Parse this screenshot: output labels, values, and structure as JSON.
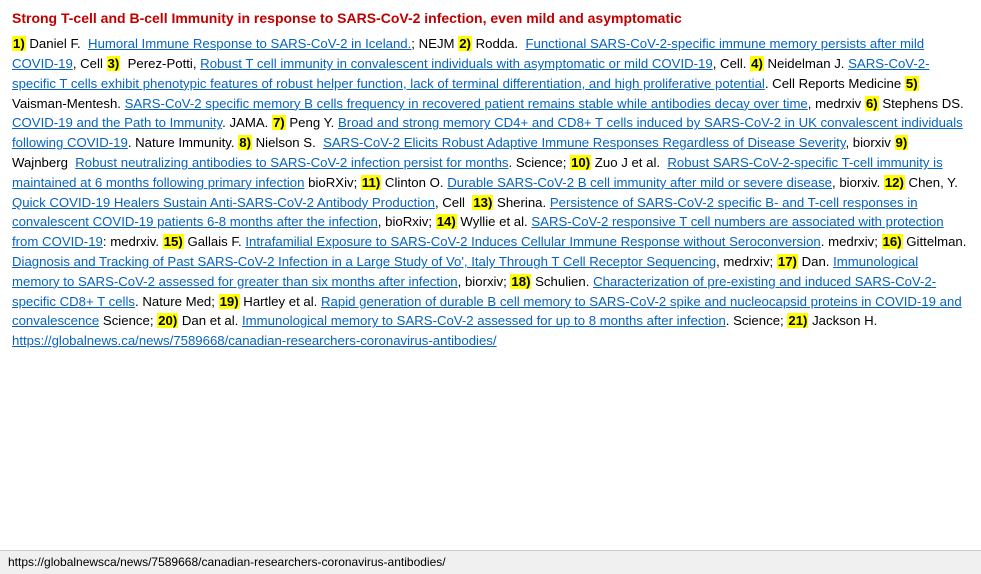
{
  "title": "Strong T-cell and B-cell Immunity in response to SARS-CoV-2 infection, even mild and asymptomatic",
  "statusBar": "https://globalnewsca/news/7589668/canadian-researchers-coronavirus-antibodies/",
  "refs": [
    {
      "num": "1)",
      "author": "Daniel F. ",
      "linkText": "Humoral Immune Response to SARS-CoV-2 in Iceland.",
      "rest": "; NEJM "
    },
    {
      "num": "2)",
      "author": "Rodda. ",
      "linkText": "Functional SARS-CoV-2-specific immune memory persists after mild COVID-19",
      "rest": ", Cell "
    },
    {
      "num": "3)",
      "author": "Perez-Potti, ",
      "linkText": "Robust T cell immunity in convalescent individuals with asymptomatic or mild COVID-19",
      "rest": ", Cell. "
    },
    {
      "num": "4)",
      "author": "Neidelman J. ",
      "linkText": "SARS-CoV-2-specific T cells exhibit phenotypic features of robust helper function, lack of terminal differentiation, and high proliferative potential",
      "rest": ". Cell Reports Medicine "
    },
    {
      "num": "5)",
      "author": "Vaisman-Mentesh. ",
      "linkText": "SARS-CoV-2 specific memory B cells frequency in recovered patient remains stable while antibodies decay over time",
      "rest": ", medrxiv "
    },
    {
      "num": "6)",
      "author": "Stephens DS. ",
      "linkText": "COVID-19 and the Path to Immunity",
      "rest": ". JAMA. "
    },
    {
      "num": "7)",
      "author": "Peng Y. ",
      "linkText": "Broad and strong memory CD4+ and CD8+ T cells induced by SARS-CoV-2 in UK convalescent individuals following COVID-19",
      "rest": ". Nature Immunity. "
    },
    {
      "num": "8)",
      "author": "Nielson S. ",
      "linkText": "SARS-CoV-2 Elicits Robust Adaptive Immune Responses Regardless of Disease Severity",
      "rest": ", biorxiv "
    },
    {
      "num": "9)",
      "author": "Wajnberg ",
      "linkText": "Robust neutralizing antibodies to SARS-CoV-2 infection persist for months",
      "rest": ". Science; "
    },
    {
      "num": "10)",
      "author": "Zuo J et al. ",
      "linkText": "Robust SARS-CoV-2-specific T-cell immunity is maintained at 6 months following primary infection",
      "rest": " bioRXiv; "
    },
    {
      "num": "11)",
      "author": "Clinton O. ",
      "linkText": "Durable SARS-CoV-2 B cell immunity after mild or severe disease",
      "rest": ", biorxiv. "
    },
    {
      "num": "12)",
      "author": "Chen, Y. ",
      "linkText": "Quick COVID-19 Healers Sustain Anti-SARS-CoV-2 Antibody Production",
      "rest": ", Cell  "
    },
    {
      "num": "13)",
      "author": "Sherina. ",
      "linkText": "Persistence of SARS-CoV-2 specific B- and T-cell responses in convalescent COVID-19 patients 6-8 months after the infection",
      "rest": ", bioRxiv; "
    },
    {
      "num": "14)",
      "author": "Wyllie et al. ",
      "linkText": "SARS-CoV-2 responsive T cell numbers are associated with protection from COVID-19",
      "rest": ": medrxiv. "
    },
    {
      "num": "15)",
      "author": "Gallais F. ",
      "linkText": "Intrafamilial Exposure to SARS-CoV-2 Induces Cellular Immune Response without Seroconversion",
      "rest": ". medrxiv; "
    },
    {
      "num": "16)",
      "author": "Gittelman. ",
      "linkText": "Diagnosis and Tracking of Past SARS-CoV-2 Infection in a Large Study of Vo', Italy Through T Cell Receptor Sequencing",
      "rest": ", medrxiv; "
    },
    {
      "num": "17)",
      "author": "Dan. ",
      "linkText": "Immunological memory to SARS-CoV-2 assessed for greater than six months after infection",
      "rest": ", biorxiv; "
    },
    {
      "num": "18)",
      "author": "Schulien. ",
      "linkText": "Characterization of pre-existing and induced SARS-CoV-2-specific CD8+ T cells",
      "rest": ". Nature Med; "
    },
    {
      "num": "19)",
      "author": "Hartley et al. ",
      "linkText": "Rapid generation of durable B cell memory to SARS-CoV-2 spike and nucleocapsid proteins in COVID-19 and convalescence",
      "rest": " Science; "
    },
    {
      "num": "20)",
      "author": "Dan et al. ",
      "linkText": "Immunological memory to SARS-CoV-2 assessed for up to 8 months after infection",
      "rest": ". Science; "
    },
    {
      "num": "21)",
      "author": "Jackson H. ",
      "linkText": "https://globalnews.ca/news/7589668/canadian-researchers-coronavirus-antibodies/",
      "rest": ""
    }
  ]
}
